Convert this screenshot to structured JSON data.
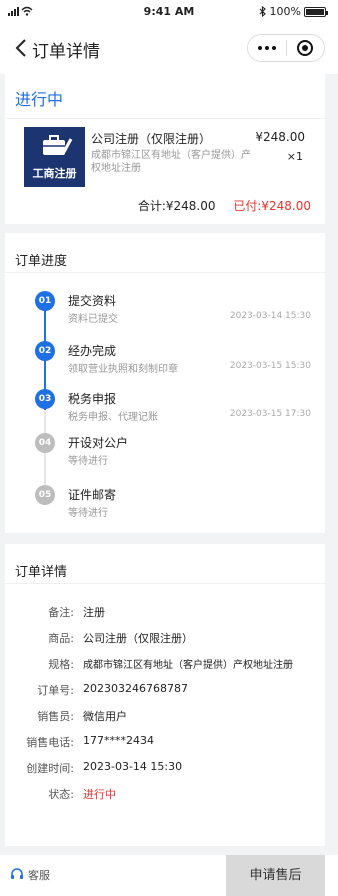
{
  "status_bar": {
    "time": "9:41 AM",
    "battery": "100%",
    "battery_level": 1.0
  },
  "nav": {
    "title": "订单详情",
    "back_icon": "chevron-left-icon",
    "more_icon": "more-dots-icon",
    "close_icon": "target-icon"
  },
  "order": {
    "status": "进行中",
    "product": {
      "thumb_label": "工商注册",
      "name": "公司注册（仅限注册）",
      "spec": "成都市锦江区有地址（客户提供）产权地址注册",
      "price": "¥248.00",
      "qty": "×1"
    },
    "total": "合计:¥248.00",
    "paid": "已付:¥248.00"
  },
  "progress": {
    "title": "订单进度",
    "steps": [
      {
        "num": "01",
        "name": "提交资料",
        "desc": "资料已提交",
        "time": "2023-03-14  15:30",
        "done": true
      },
      {
        "num": "02",
        "name": "经办完成",
        "desc": "领取营业执照和刻制印章",
        "time": "2023-03-15  15:30",
        "done": true
      },
      {
        "num": "03",
        "name": "税务申报",
        "desc": "税务申报、代理记账",
        "time": "2023-03-15  17:30",
        "done": true
      },
      {
        "num": "04",
        "name": "开设对公户",
        "desc": "等待进行",
        "time": "",
        "done": false
      },
      {
        "num": "05",
        "name": "证件邮寄",
        "desc": "等待进行",
        "time": "",
        "done": false
      }
    ]
  },
  "details": {
    "title": "订单详情",
    "rows": [
      {
        "label": "备注:",
        "value": "注册"
      },
      {
        "label": "商品:",
        "value": "公司注册（仅限注册）"
      },
      {
        "label": "规格:",
        "value": "成都市锦江区有地址（客户提供）产权地址注册"
      },
      {
        "label": "订单号:",
        "value": "202303246768787"
      },
      {
        "label": "销售员:",
        "value": "微信用户"
      },
      {
        "label": "销售电话:",
        "value": "177****2434"
      },
      {
        "label": "创建时间:",
        "value": "2023-03-14  15:30"
      },
      {
        "label": "状态:",
        "value": "进行中",
        "highlight": true
      }
    ]
  },
  "bottom": {
    "service_label": "客服",
    "service_icon": "headset-icon",
    "after_sale_label": "申请售后"
  },
  "colors": {
    "accent": "#1f6fe5",
    "danger": "#e4322c",
    "pending": "#bdbdbd"
  }
}
